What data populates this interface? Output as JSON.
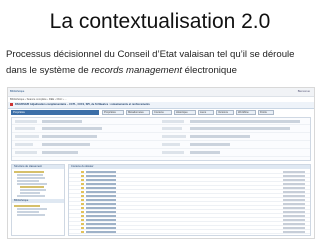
{
  "slide": {
    "title": "La contextualisation 2.0",
    "body_line1": "Processus décisionnel du Conseil d’Etat valaisan tel qu’il se déroule",
    "body_line2_pre": "dans le système de ",
    "body_line2_em": "records management",
    "body_line2_post": " électronique"
  },
  "screenshot": {
    "topbar_title": "Bibliothèque",
    "topbar_right": "Bienvenue",
    "breadcrumb": "Bibliothèque › Séance complète › DEE › DGC › ...",
    "window_title": "DSC/DSC/R Adjudication complémentaire – CCTL, CCFJ, SPI, de St Maurice : remaniements et renforcements",
    "left_panel_title": "Propriétés",
    "left_tree_header": "Structure de classement",
    "left_tree_header2": "Bibliothèque",
    "right_panel_header": "Contenu du dossier",
    "tabs": [
      "Propriétés",
      "Métadonnées",
      "Contenu",
      "Historique",
      "Liens",
      "Versions",
      "Workflow",
      "Droits"
    ]
  },
  "colors": {
    "accent": "#3c6fa8",
    "folder": "#e2c25b"
  }
}
